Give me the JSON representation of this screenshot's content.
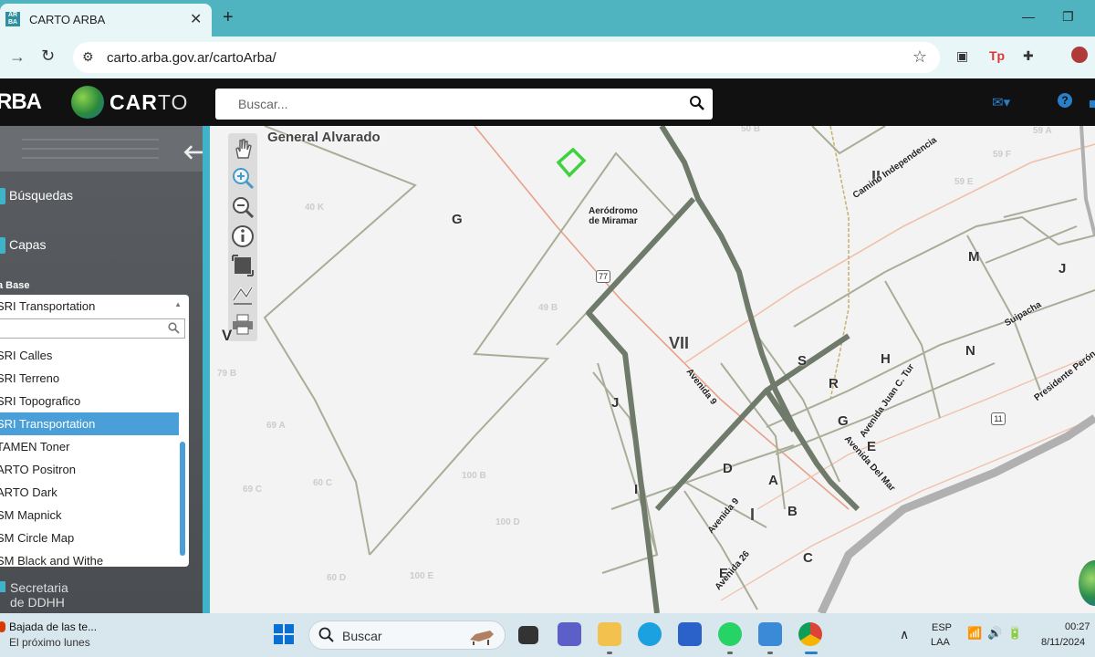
{
  "browser": {
    "tab_title": "CARTO ARBA",
    "tab_favicon_text": "AR BA",
    "url": "carto.arba.gov.ar/cartoArba/",
    "new_tab": "+",
    "close": "✕"
  },
  "app": {
    "logo": "RBA",
    "brand_bold": "CAR",
    "brand_thin": "TO",
    "search_placeholder": "Buscar..."
  },
  "sidebar": {
    "items": [
      {
        "label": "Búsquedas"
      },
      {
        "label": "Capas"
      }
    ],
    "base_label": "a Base",
    "base_selected": "SRI Transportation",
    "options": [
      {
        "label": "SRI Calles",
        "selected": false
      },
      {
        "label": "SRI Terreno",
        "selected": false
      },
      {
        "label": "SRI Topografico",
        "selected": false
      },
      {
        "label": "SRI Transportation",
        "selected": true
      },
      {
        "label": "TAMEN Toner",
        "selected": false
      },
      {
        "label": "ARTO Positron",
        "selected": false
      },
      {
        "label": "ARTO Dark",
        "selected": false
      },
      {
        "label": "SM Mapnick",
        "selected": false
      },
      {
        "label": "SM Circle Map",
        "selected": false
      },
      {
        "label": "SM Black and Withe",
        "selected": false
      }
    ],
    "bottom_item": "Secretaria de DDHH"
  },
  "map": {
    "district": "General Alvarado",
    "aerodrome_line1": "Aeródromo",
    "aerodrome_line2": "de Miramar",
    "route_77": "77",
    "route_11": "11",
    "letters": [
      {
        "t": "G"
      },
      {
        "t": "J"
      },
      {
        "t": "I"
      },
      {
        "t": "D"
      },
      {
        "t": "A"
      },
      {
        "t": "B"
      },
      {
        "t": "E"
      },
      {
        "t": "C"
      },
      {
        "t": "S"
      },
      {
        "t": "R"
      },
      {
        "t": "H"
      },
      {
        "t": "G"
      },
      {
        "t": "E"
      },
      {
        "t": "N"
      },
      {
        "t": "M"
      },
      {
        "t": "J"
      },
      {
        "t": "V"
      }
    ],
    "romans": [
      {
        "t": "VII"
      },
      {
        "t": "II"
      },
      {
        "t": "I"
      }
    ],
    "streets": [
      {
        "t": "Avenida 9"
      },
      {
        "t": "Avenida 9"
      },
      {
        "t": "Avenida 26"
      },
      {
        "t": "Avenida Juan C. Tur"
      },
      {
        "t": "Avenida Del Mar"
      },
      {
        "t": "Camino Independencia"
      },
      {
        "t": "Suipacha"
      },
      {
        "t": "Presidente Perón"
      }
    ],
    "parcels": [
      {
        "t": "40 K"
      },
      {
        "t": "49 B"
      },
      {
        "t": "79 B"
      },
      {
        "t": "69 A"
      },
      {
        "t": "69 C"
      },
      {
        "t": "60 C"
      },
      {
        "t": "100 B"
      },
      {
        "t": "100 D"
      },
      {
        "t": "60 D"
      },
      {
        "t": "100 E"
      },
      {
        "t": "50 B"
      },
      {
        "t": "59 F"
      },
      {
        "t": "59 E"
      },
      {
        "t": "59 A"
      }
    ]
  },
  "taskbar": {
    "notif_title": "Bajada de las te...",
    "notif_sub": "El próximo lunes",
    "search_text": "Buscar",
    "lang_top": "ESP",
    "lang_bottom": "LAA",
    "time": "00:27",
    "date": "8/11/2024"
  },
  "colors": {
    "tabbar": "#4fb3c0",
    "accent": "#3fb4c8",
    "selected_option": "#4a9fd8",
    "parcel_line": "#a8ad98",
    "district_line": "#6f7a6a",
    "road": "#e8a088"
  }
}
